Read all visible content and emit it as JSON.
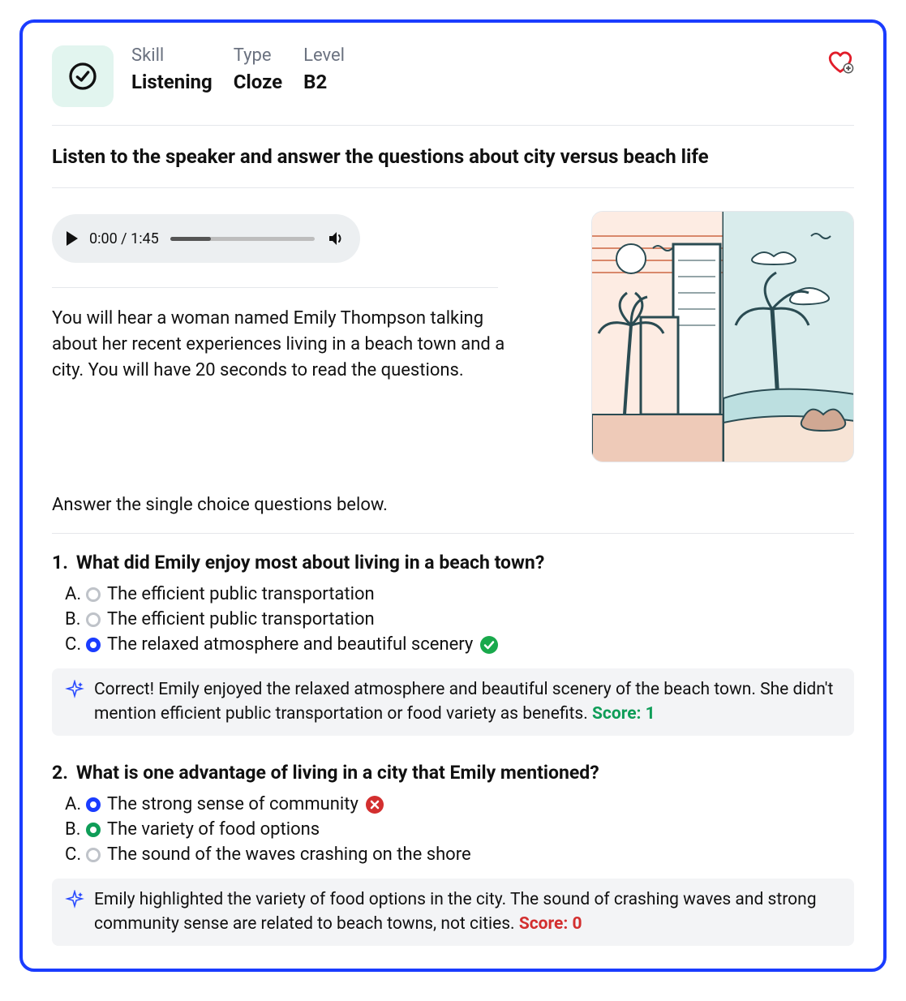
{
  "header": {
    "skill_label": "Skill",
    "skill_value": "Listening",
    "type_label": "Type",
    "type_value": "Cloze",
    "level_label": "Level",
    "level_value": "B2"
  },
  "title": "Listen to the speaker and answer the questions about city versus beach life",
  "audio": {
    "current_time": "0:00",
    "duration": "1:45"
  },
  "passage": "You will hear a woman named Emily Thompson talking about her recent experiences living in a beach town and a city. You will have 20 seconds to read the questions.",
  "instruction": "Answer the single choice questions below.",
  "questions": [
    {
      "number": "1.",
      "text": "What did Emily enjoy most about living in a beach town?",
      "options": [
        {
          "letter": "A.",
          "text": "The efficient public transportation",
          "selected": "none"
        },
        {
          "letter": "B.",
          "text": "The efficient public transportation",
          "selected": "none"
        },
        {
          "letter": "C.",
          "text": "The relaxed atmosphere and beautiful scenery",
          "selected": "blue",
          "status": "correct"
        }
      ],
      "feedback_text": "Correct! Emily enjoyed the relaxed atmosphere and beautiful scenery of the beach town. She didn't mention efficient public transportation or food variety as benefits. ",
      "score_text": "Score: 1",
      "score_class": "score-green"
    },
    {
      "number": "2.",
      "text": "What is one advantage of living in a city that Emily mentioned?",
      "options": [
        {
          "letter": "A.",
          "text": "The strong sense of community",
          "selected": "blue",
          "status": "wrong"
        },
        {
          "letter": "B.",
          "text": "The variety of food options",
          "selected": "green"
        },
        {
          "letter": "C.",
          "text": "The sound of the waves crashing on the shore",
          "selected": "none"
        }
      ],
      "feedback_text": "Emily highlighted the variety of food options in the city. The sound of crashing waves and strong community sense are related to beach towns, not cities. ",
      "score_text": "Score: 0",
      "score_class": "score-red"
    }
  ]
}
